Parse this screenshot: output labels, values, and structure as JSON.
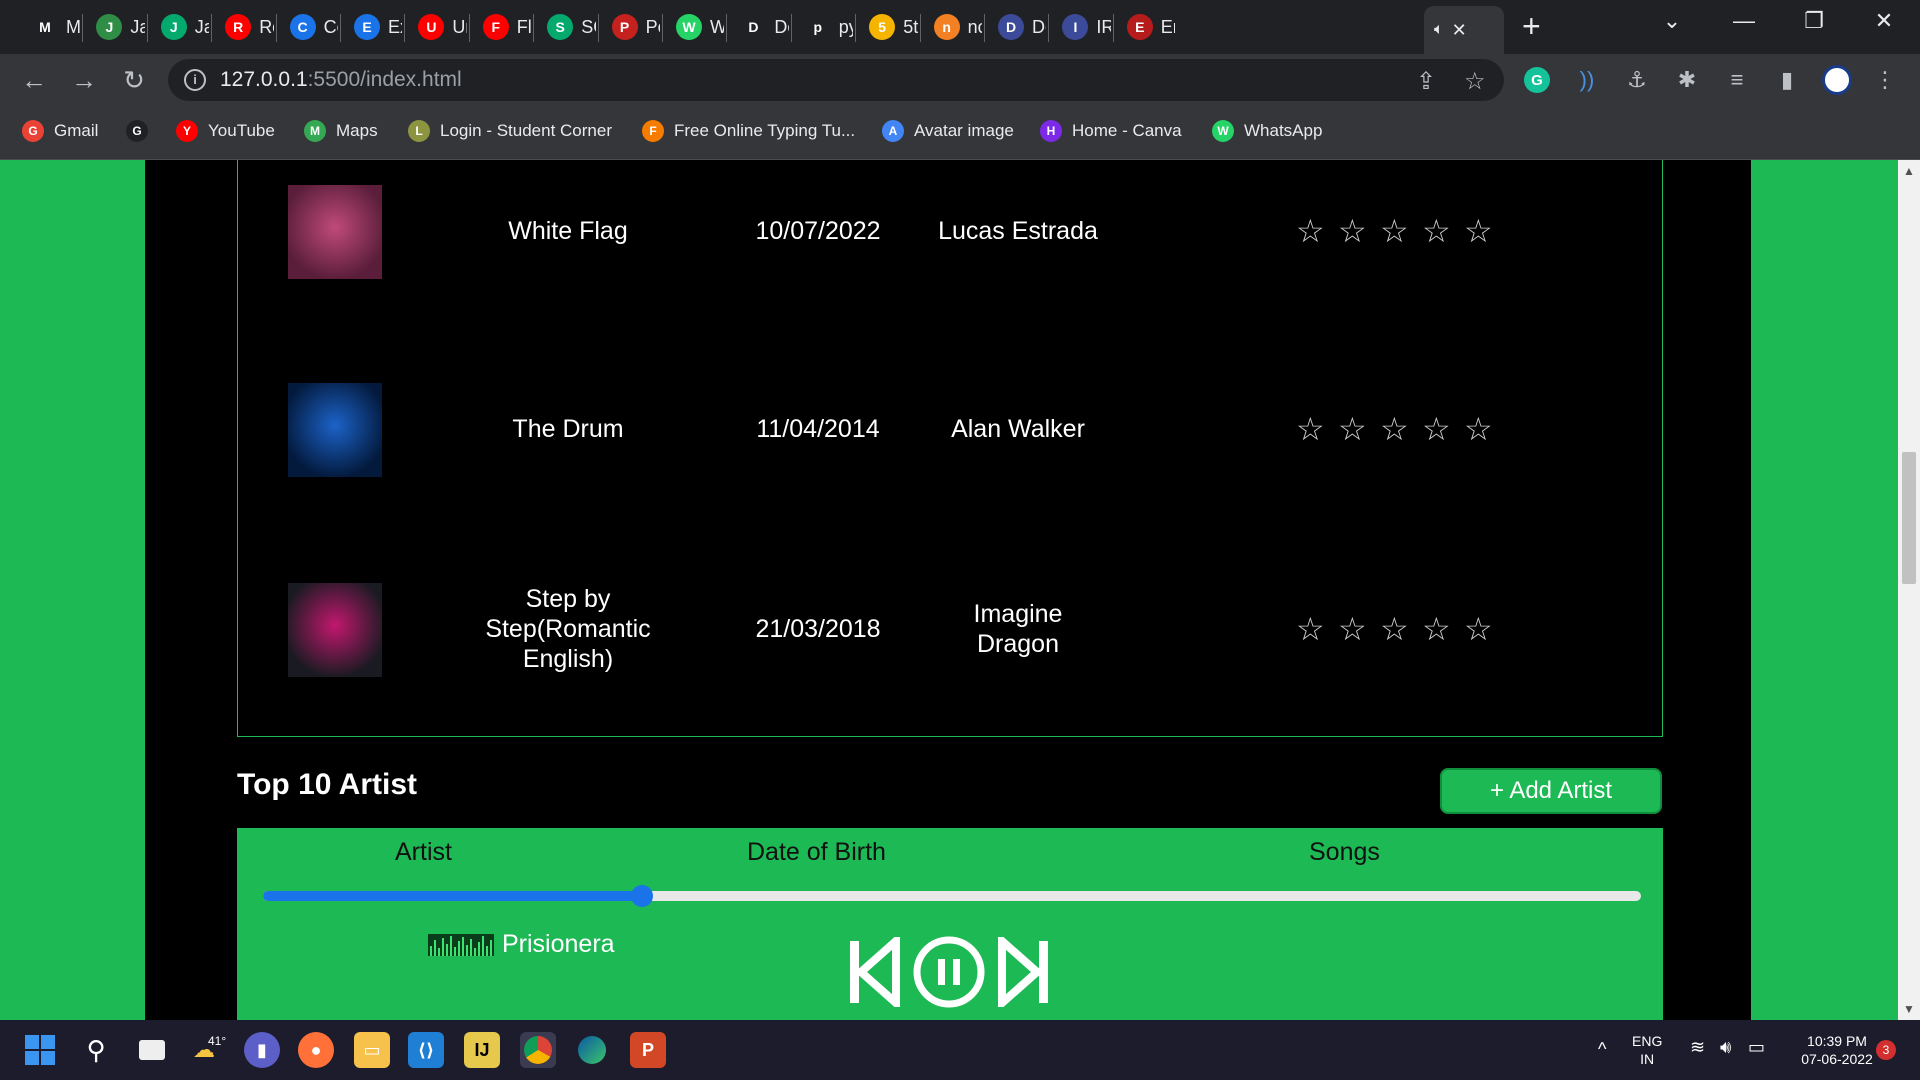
{
  "tabs": [
    {
      "label": "Mi",
      "icon": "music-icon",
      "color": "#202124"
    },
    {
      "label": "Ja",
      "icon": "gfg-icon",
      "color": "#2f8d46"
    },
    {
      "label": "Ja",
      "icon": "w3schools-icon",
      "color": "#04aa6d"
    },
    {
      "label": "Re",
      "icon": "youtube-icon",
      "color": "#ff0000"
    },
    {
      "label": "Cc",
      "icon": "c-icon",
      "color": "#1a73e8"
    },
    {
      "label": "Ex",
      "icon": "c-icon",
      "color": "#1a73e8"
    },
    {
      "label": "Ur",
      "icon": "youtube-icon",
      "color": "#ff0000"
    },
    {
      "label": "FlI",
      "icon": "youtube-icon",
      "color": "#ff0000"
    },
    {
      "label": "SC",
      "icon": "w3schools-icon",
      "color": "#04aa6d"
    },
    {
      "label": "Pe",
      "icon": "box-icon",
      "color": "#c5221f"
    },
    {
      "label": "W",
      "icon": "whatsapp-icon",
      "color": "#25d366"
    },
    {
      "label": "Dc",
      "icon": "download-icon",
      "color": "#202124"
    },
    {
      "label": "py",
      "icon": "github-icon",
      "color": "#202124"
    },
    {
      "label": "5t",
      "icon": "drive-icon",
      "color": "#f4b400"
    },
    {
      "label": "nc",
      "icon": "stackoverflow-icon",
      "color": "#f48024"
    },
    {
      "label": "De",
      "icon": "doc-icon",
      "color": "#3c4a9a"
    },
    {
      "label": "IR",
      "icon": "doc-icon",
      "color": "#3c4a9a"
    },
    {
      "label": "En",
      "icon": "avatar-icon",
      "color": "#b71c1c"
    }
  ],
  "address": {
    "host": "127.0.0.1",
    "rest": ":5500/index.html"
  },
  "bookmarks": [
    {
      "label": "Gmail",
      "icon": "gmail-icon",
      "color": "#ea4335"
    },
    {
      "label": "",
      "icon": "github-icon",
      "color": "#202124"
    },
    {
      "label": "YouTube",
      "icon": "youtube-icon",
      "color": "#ff0000"
    },
    {
      "label": "Maps",
      "icon": "maps-icon",
      "color": "#34a853"
    },
    {
      "label": "Login - Student Corner",
      "icon": "student-icon",
      "color": "#8d9440"
    },
    {
      "label": "Free Online Typing Tu...",
      "icon": "typing-icon",
      "color": "#f57c00"
    },
    {
      "label": "Avatar image",
      "icon": "pinwheel-icon",
      "color": "#4285f4"
    },
    {
      "label": "Home - Canva",
      "icon": "canva-icon",
      "color": "#7d2ae8"
    },
    {
      "label": "WhatsApp",
      "icon": "whatsapp-icon",
      "color": "#25d366"
    }
  ],
  "songs": [
    {
      "title": "White Flag",
      "date": "10/07/2022",
      "artist": "Lucas Estrada",
      "cover_colors": [
        "#5a1e3a",
        "#c04a7a"
      ]
    },
    {
      "title": "The Drum",
      "date": "11/04/2014",
      "artist": "Alan Walker",
      "cover_colors": [
        "#031a3d",
        "#1c63c9"
      ]
    },
    {
      "title": "Step by Step(Romantic English)",
      "date": "21/03/2018",
      "artist": "Imagine Dragon",
      "cover_colors": [
        "#1a1a22",
        "#c2186e"
      ]
    }
  ],
  "rating_max": 5,
  "artist_section": {
    "heading": "Top 10 Artist",
    "add_button": "+ Add Artist",
    "columns": [
      "Artist",
      "Date of Birth",
      "Songs"
    ]
  },
  "player": {
    "now_playing": "Prisionera",
    "progress": 0.275,
    "accent": "#1a73e8"
  },
  "theme": {
    "page_green": "#1db954",
    "panel_black": "#000000"
  },
  "taskbar": {
    "weather": "41°",
    "lang_top": "ENG",
    "lang_bottom": "IN",
    "time": "10:39 PM",
    "date": "07-06-2022",
    "notifications": "3"
  }
}
